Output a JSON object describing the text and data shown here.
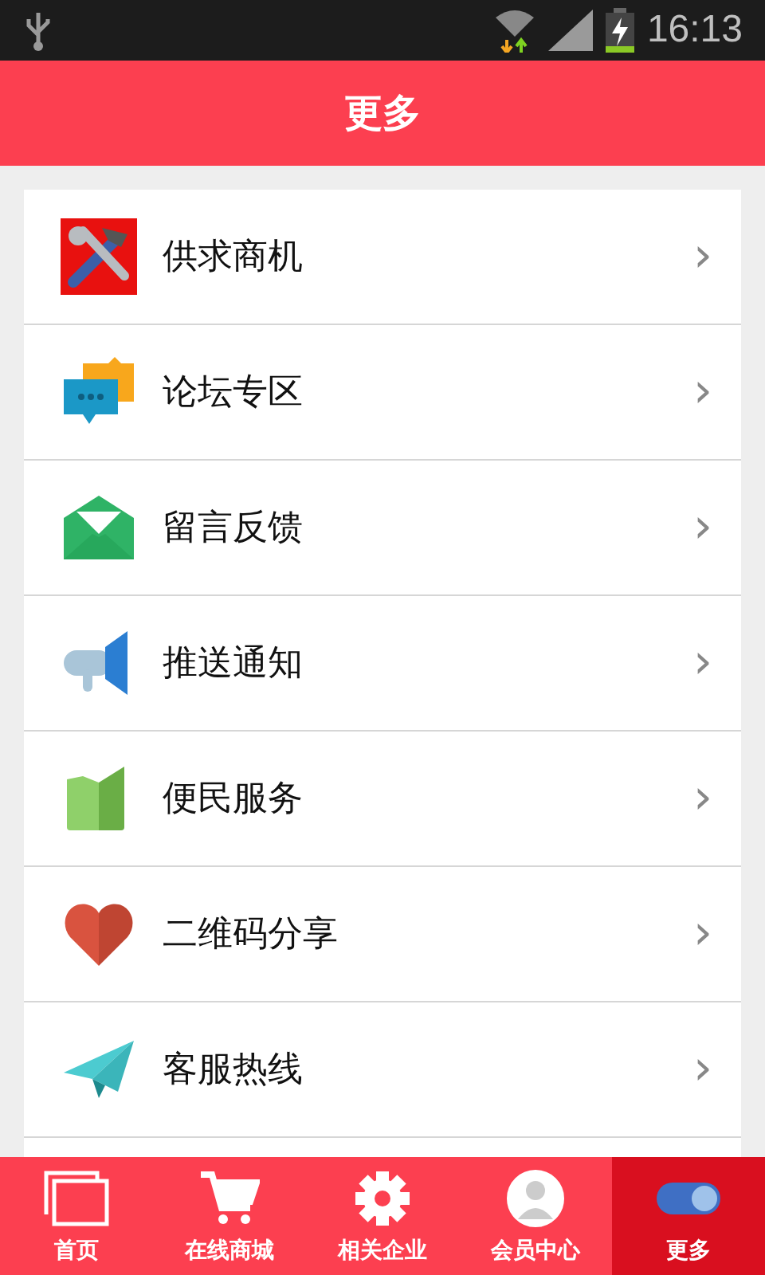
{
  "status_bar": {
    "time": "16:13"
  },
  "header": {
    "title": "更多"
  },
  "menu": [
    {
      "label": "供求商机",
      "kind": "tools",
      "chevron": "›"
    },
    {
      "label": "论坛专区",
      "kind": "chat",
      "chevron": "›"
    },
    {
      "label": "留言反馈",
      "kind": "mail",
      "chevron": "›"
    },
    {
      "label": "推送通知",
      "kind": "megaphone",
      "chevron": "›"
    },
    {
      "label": "便民服务",
      "kind": "map",
      "chevron": "›"
    },
    {
      "label": "二维码分享",
      "kind": "heart",
      "chevron": "›"
    },
    {
      "label": "客服热线",
      "kind": "plane",
      "chevron": "›"
    }
  ],
  "tabs": [
    {
      "label": "首页",
      "kind": "pages",
      "selected": false
    },
    {
      "label": "在线商城",
      "kind": "cart",
      "selected": false
    },
    {
      "label": "相关企业",
      "kind": "gear",
      "selected": false
    },
    {
      "label": "会员中心",
      "kind": "user",
      "selected": false
    },
    {
      "label": "更多",
      "kind": "toggle",
      "selected": true
    }
  ]
}
